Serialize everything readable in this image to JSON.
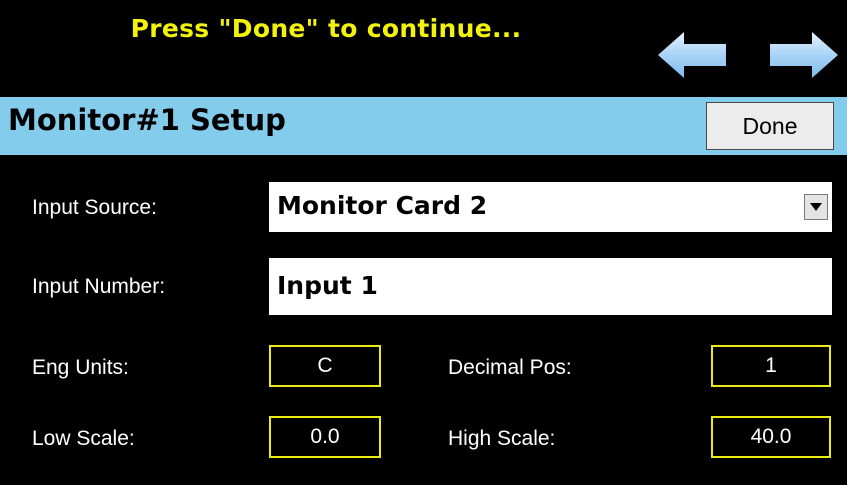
{
  "prompt": "Press \"Done\" to continue...",
  "icons": {
    "back": "arrow-left-icon",
    "forward": "arrow-right-icon"
  },
  "colors": {
    "prompt_text": "#f2f20c",
    "header_bg": "#84ccec",
    "field_border": "#ecec14",
    "arrow": "#aad4f8"
  },
  "header": {
    "title": "Monitor#1 Setup",
    "done_label": "Done"
  },
  "form": {
    "input_source": {
      "label": "Input Source:",
      "value": "Monitor Card 2"
    },
    "input_number": {
      "label": "Input Number:",
      "value": "Input 1"
    },
    "eng_units": {
      "label": "Eng Units:",
      "value": "C"
    },
    "decimal_pos": {
      "label": "Decimal Pos:",
      "value": "1"
    },
    "low_scale": {
      "label": "Low Scale:",
      "value": "0.0"
    },
    "high_scale": {
      "label": "High Scale:",
      "value": "40.0"
    }
  }
}
